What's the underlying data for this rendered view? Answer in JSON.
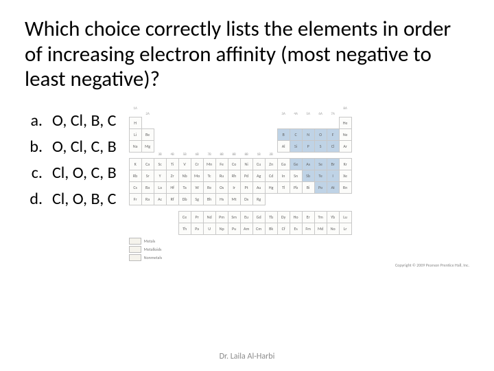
{
  "question": "Which choice correctly lists the elements in order of increasing electron affinity (most negative to least negative)?",
  "choices": [
    {
      "letter": "a.",
      "text": "O, Cl, B, C"
    },
    {
      "letter": "b.",
      "text": "O, Cl, C, B"
    },
    {
      "letter": "c.",
      "text": "Cl, O, C, B"
    },
    {
      "letter": "d.",
      "text": "Cl, O, B, C"
    }
  ],
  "footer": "Dr. Laila Al-Harbi",
  "periodic_table": {
    "group_labels_top": [
      "1A",
      "",
      "",
      "",
      "",
      "",
      "",
      "",
      "",
      "",
      "",
      "",
      "",
      "",
      "",
      "",
      "",
      "8A"
    ],
    "group_labels_sub": [
      "",
      "2A",
      "",
      "",
      "",
      "",
      "",
      "",
      "",
      "",
      "",
      "",
      "3A",
      "4A",
      "5A",
      "6A",
      "7A",
      ""
    ],
    "group_labels_mid": [
      "",
      "",
      "3B",
      "4B",
      "5B",
      "6B",
      "7B",
      "8B",
      "8B",
      "8B",
      "1B",
      "2B",
      "",
      "",
      "",
      "",
      "",
      ""
    ],
    "highlighted": [
      "B",
      "C",
      "N",
      "O",
      "F",
      "Si",
      "P",
      "S",
      "Cl",
      "Ge",
      "As",
      "Se",
      "Br",
      "Sb",
      "Te",
      "I",
      "Po",
      "At"
    ],
    "rows": [
      [
        "H",
        "",
        "",
        "",
        "",
        "",
        "",
        "",
        "",
        "",
        "",
        "",
        "",
        "",
        "",
        "",
        "",
        "He"
      ],
      [
        "Li",
        "Be",
        "",
        "",
        "",
        "",
        "",
        "",
        "",
        "",
        "",
        "",
        "B",
        "C",
        "N",
        "O",
        "F",
        "Ne"
      ],
      [
        "Na",
        "Mg",
        "",
        "",
        "",
        "",
        "",
        "",
        "",
        "",
        "",
        "",
        "Al",
        "Si",
        "P",
        "S",
        "Cl",
        "Ar"
      ],
      [
        "K",
        "Ca",
        "Sc",
        "Ti",
        "V",
        "Cr",
        "Mn",
        "Fe",
        "Co",
        "Ni",
        "Cu",
        "Zn",
        "Ga",
        "Ge",
        "As",
        "Se",
        "Br",
        "Kr"
      ],
      [
        "Rb",
        "Sr",
        "Y",
        "Zr",
        "Nb",
        "Mo",
        "Tc",
        "Ru",
        "Rh",
        "Pd",
        "Ag",
        "Cd",
        "In",
        "Sn",
        "Sb",
        "Te",
        "I",
        "Xe"
      ],
      [
        "Cs",
        "Ba",
        "La",
        "Hf",
        "Ta",
        "W",
        "Re",
        "Os",
        "Ir",
        "Pt",
        "Au",
        "Hg",
        "Tl",
        "Pb",
        "Bi",
        "Po",
        "At",
        "Rn"
      ],
      [
        "Fr",
        "Ra",
        "Ac",
        "Rf",
        "Db",
        "Sg",
        "Bh",
        "Hs",
        "Mt",
        "Ds",
        "Rg",
        "",
        "",
        "",
        "",
        "",
        "",
        ""
      ]
    ],
    "lanthanides": [
      "Ce",
      "Pr",
      "Nd",
      "Pm",
      "Sm",
      "Eu",
      "Gd",
      "Tb",
      "Dy",
      "Ho",
      "Er",
      "Tm",
      "Yb",
      "Lu"
    ],
    "actinides": [
      "Th",
      "Pa",
      "U",
      "Np",
      "Pu",
      "Am",
      "Cm",
      "Bk",
      "Cf",
      "Es",
      "Fm",
      "Md",
      "No",
      "Lr"
    ],
    "legend": [
      "Metals",
      "Metalloids",
      "Nonmetals"
    ],
    "copyright": "Copyright © 2009 Pearson Prentice Hall, Inc."
  }
}
